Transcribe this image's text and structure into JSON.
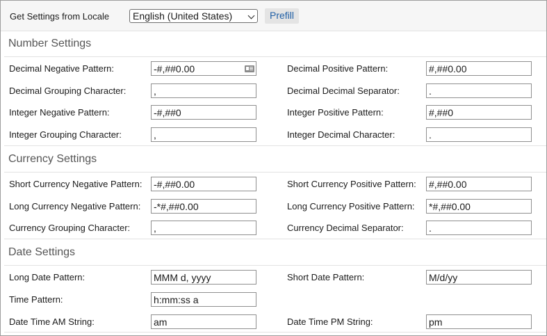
{
  "locale_bar": {
    "label": "Get Settings from Locale",
    "selected_locale": "English (United States)",
    "prefill_label": "Prefill"
  },
  "number": {
    "heading": "Number Settings",
    "decimal_negative": {
      "label": "Decimal Negative Pattern:",
      "value": "-#,##0.00"
    },
    "decimal_positive": {
      "label": "Decimal Positive Pattern:",
      "value": "#,##0.00"
    },
    "decimal_grouping": {
      "label": "Decimal Grouping Character:",
      "value": ","
    },
    "decimal_separator": {
      "label": "Decimal Decimal Separator:",
      "value": "."
    },
    "integer_negative": {
      "label": "Integer Negative Pattern:",
      "value": "-#,##0"
    },
    "integer_positive": {
      "label": "Integer Positive Pattern:",
      "value": "#,##0"
    },
    "integer_grouping": {
      "label": "Integer Grouping Character:",
      "value": ","
    },
    "integer_decimal": {
      "label": "Integer Decimal Character:",
      "value": "."
    }
  },
  "currency": {
    "heading": "Currency Settings",
    "short_negative": {
      "label": "Short Currency Negative Pattern:",
      "value": "-#,##0.00"
    },
    "short_positive": {
      "label": "Short Currency Positive Pattern:",
      "value": "#,##0.00"
    },
    "long_negative": {
      "label": "Long Currency Negative Pattern:",
      "value": "-*#,##0.00"
    },
    "long_positive": {
      "label": "Long Currency Positive Pattern:",
      "value": "*#,##0.00"
    },
    "grouping": {
      "label": "Currency Grouping Character:",
      "value": ","
    },
    "decimal_separator": {
      "label": "Currency Decimal Separator:",
      "value": "."
    }
  },
  "date": {
    "heading": "Date Settings",
    "long_date": {
      "label": "Long Date Pattern:",
      "value": "MMM d, yyyy"
    },
    "short_date": {
      "label": "Short Date Pattern:",
      "value": "M/d/yy"
    },
    "time": {
      "label": "Time Pattern:",
      "value": "h:mm:ss a"
    },
    "am": {
      "label": "Date Time AM String:",
      "value": "am"
    },
    "pm": {
      "label": "Date Time PM String:",
      "value": "pm"
    }
  }
}
